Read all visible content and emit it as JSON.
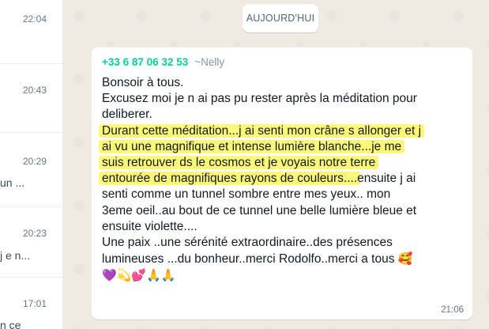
{
  "chat_list": {
    "rows": [
      {
        "time": "22:04",
        "snippet": ""
      },
      {
        "time": "20:43",
        "snippet": ""
      },
      {
        "time": "20:29",
        "snippet": "un ..."
      },
      {
        "time": "20:23",
        "snippet": "j e n..."
      },
      {
        "time": "17:01",
        "snippet": "n ce"
      }
    ]
  },
  "conversation": {
    "date_chip": "AUJOURD'HUI",
    "message": {
      "sender_phone": "+33 6 87 06 32 53",
      "sender_name": "~Nelly",
      "lines": [
        "Bonsoir à tous.",
        "Excusez moi je n ai pas pu rester après la méditation pour",
        "deliberer.",
        "Durant cette méditation...j ai senti mon crâne s allonger et j",
        "ai vu une magnifique et intense lumière blanche...je me",
        "suis retrouver ds le cosmos et je voyais notre terre",
        "entourée de magnifiques rayons de couleurs....",
        "ensuite j ai",
        "senti comme un tunnel sombre entre mes yeux.. mon",
        "3eme oeil..au bout de ce tunnel une belle lumière bleue et",
        "ensuite violette....",
        "Une paix ..une sérénité extraordinaire..des présences",
        "lumineuses ...du bonheur..merci Rodolfo..merci a tous ",
        "🥰",
        "💜💫💕🙏🙏"
      ],
      "time": "21:06"
    }
  },
  "colors": {
    "highlight": "#fef878",
    "sender_phone": "#06cf9c",
    "background": "#efeae2"
  }
}
